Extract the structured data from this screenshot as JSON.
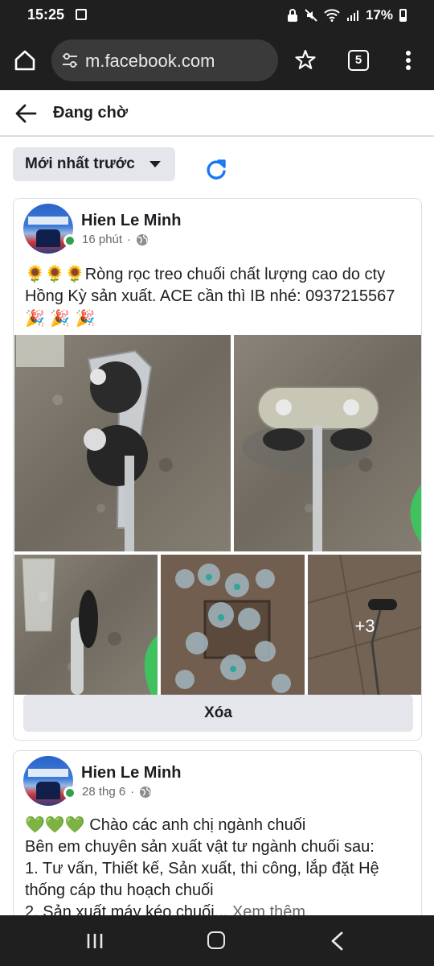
{
  "status_bar": {
    "time": "15:25",
    "battery": "17%"
  },
  "browser": {
    "url": "m.facebook.com",
    "tab_count": "5"
  },
  "header": {
    "title": "Đang chờ"
  },
  "sort": {
    "label": "Mới nhất trước"
  },
  "posts": [
    {
      "author": "Hien Le Minh",
      "time": "16 phút",
      "text_emoji_prefix": "🌻🌻🌻",
      "text": "Ròng rọc treo chuối chất lượng cao do cty Hồng Kỳ sản xuất. ACE cần thì IB nhé: 0937215567",
      "text_emoji_suffix": "🎉 🎉 🎉",
      "more_photos": "+3",
      "delete_label": "Xóa"
    },
    {
      "author": "Hien Le Minh",
      "time": "28 thg 6",
      "text_emoji_prefix": "💚💚💚",
      "line1": "Chào các anh chị ngành chuối",
      "line2": "Bên em chuyên sản xuất vật tư ngành chuối sau:",
      "line3": "1. Tư vấn, Thiết kế, Sản xuất, thi công, lắp đặt Hệ thống cáp thu hoạch chuối",
      "line4": "2. Sản xuất máy kéo chuối...",
      "see_more": "Xem thêm"
    }
  ],
  "icons": {
    "home": "home-icon",
    "tune": "tune-icon",
    "star": "star-icon",
    "menu": "more-vert-icon",
    "back": "arrow-left-icon",
    "refresh": "refresh-icon",
    "globe": "globe-icon"
  },
  "colors": {
    "online": "#31a24c",
    "refresh": "#1877f2",
    "chrome": "#1f1f1f"
  }
}
